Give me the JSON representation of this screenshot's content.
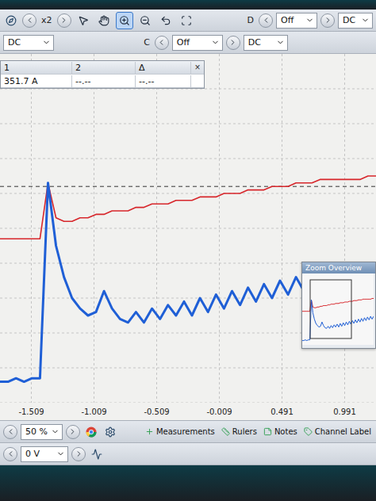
{
  "toolbar_top": {
    "zoom": "x2",
    "tools": [
      {
        "kind": "pointer",
        "selected": false
      },
      {
        "kind": "hand",
        "selected": false
      },
      {
        "kind": "zoom-in",
        "selected": true
      },
      {
        "kind": "zoom-out",
        "selected": false
      },
      {
        "kind": "undo",
        "selected": false
      },
      {
        "kind": "zoom-fit",
        "selected": false
      }
    ],
    "channel": "D",
    "range": "Off",
    "coupling": "DC"
  },
  "toolbar_second": {
    "coupling_left": "DC",
    "channel": "C",
    "range": "Off",
    "coupling": "DC"
  },
  "measurements": {
    "columns": [
      "1",
      "2",
      "Δ"
    ],
    "row": [
      "351.7 A",
      "--.--",
      "--.--"
    ],
    "close": "×"
  },
  "chart": {
    "trigger_level": 62,
    "x_ticks": [
      "-1.509",
      "-1.009",
      "-0.509",
      "-0.009",
      "0.491",
      "0.991"
    ],
    "series": [
      {
        "color": "#d7262b",
        "values": [
          47,
          47,
          47,
          47,
          47,
          47,
          63,
          53,
          52,
          52,
          53,
          53,
          54,
          54,
          55,
          55,
          55,
          56,
          56,
          57,
          57,
          57,
          58,
          58,
          58,
          59,
          59,
          59,
          60,
          60,
          60,
          61,
          61,
          61,
          62,
          62,
          62,
          63,
          63,
          63,
          64,
          64,
          64,
          64,
          64,
          64,
          65,
          65
        ]
      },
      {
        "color": "#1f5fd6",
        "values": [
          6,
          6,
          7,
          6,
          7,
          7,
          63,
          45,
          36,
          30,
          27,
          25,
          26,
          32,
          27,
          24,
          23,
          26,
          23,
          27,
          24,
          28,
          25,
          29,
          25,
          30,
          26,
          31,
          27,
          32,
          28,
          33,
          29,
          34,
          30,
          35,
          31,
          36,
          32,
          37,
          33,
          38,
          34,
          39,
          35,
          40,
          36,
          40
        ]
      }
    ]
  },
  "zoom_overview": {
    "title": "Zoom Overview"
  },
  "bottom_toolbar": {
    "zoom": "50 %",
    "tabs": [
      "Measurements",
      "Rulers",
      "Notes",
      "Channel Label"
    ]
  },
  "bottom_row": {
    "offset": "0 V"
  }
}
